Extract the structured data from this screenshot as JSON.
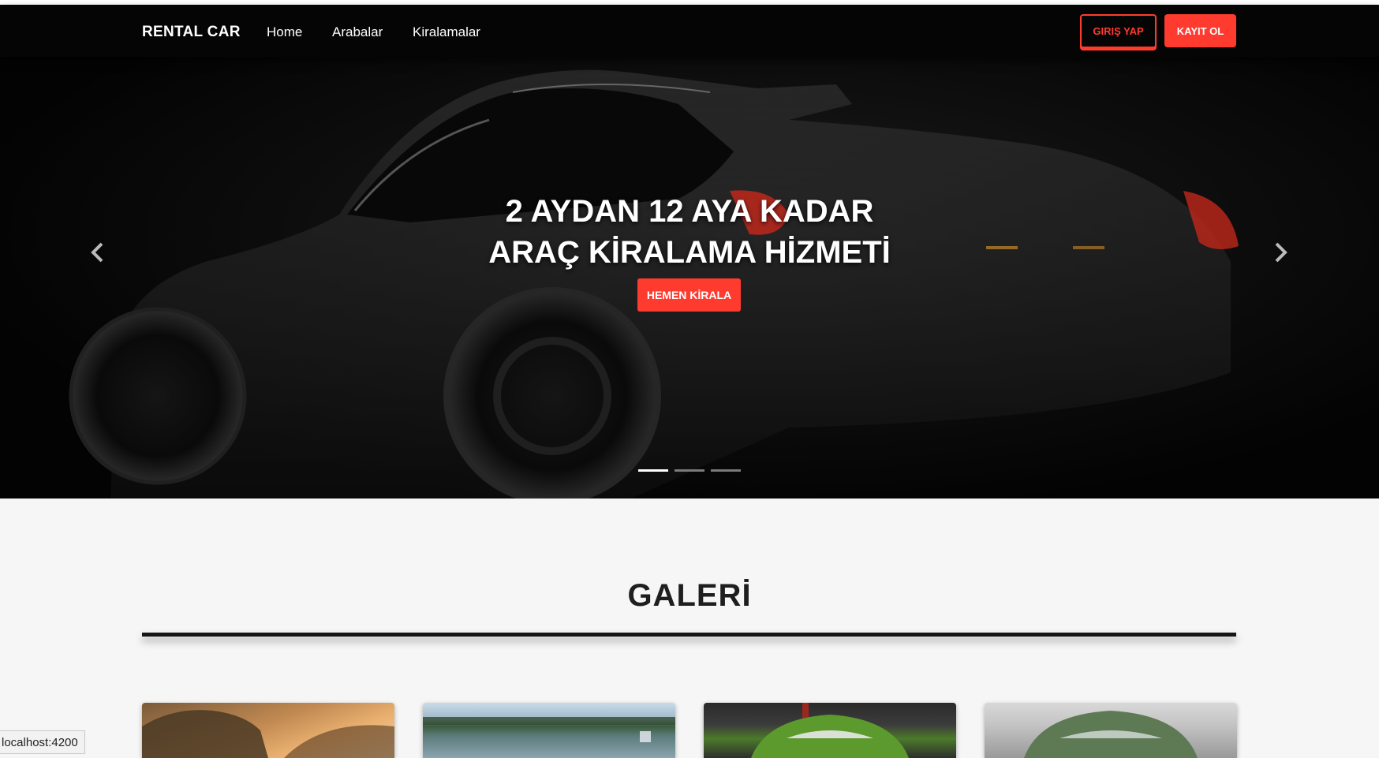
{
  "nav": {
    "brand": "RENTAL CAR",
    "links": [
      "Home",
      "Arabalar",
      "Kiralamalar"
    ],
    "login_label": "GIRIŞ YAP",
    "register_label": "KAYIT OL"
  },
  "hero": {
    "title_line1": "2 AYDAN 12 AYA KADAR",
    "title_line2": "ARAÇ KİRALAMA HİZMETİ",
    "cta_label": "HEMEN KİRALA",
    "slides": 3,
    "active_slide": 1
  },
  "gallery": {
    "title": "GALERİ",
    "cards": [
      {
        "theme": "mountain-sunset"
      },
      {
        "theme": "lake"
      },
      {
        "theme": "green-car-showroom"
      },
      {
        "theme": "green-car-white"
      }
    ]
  },
  "status_bar": {
    "url": "localhost:4200"
  },
  "colors": {
    "accent": "#ff3b30",
    "nav_bg": "#050505"
  }
}
